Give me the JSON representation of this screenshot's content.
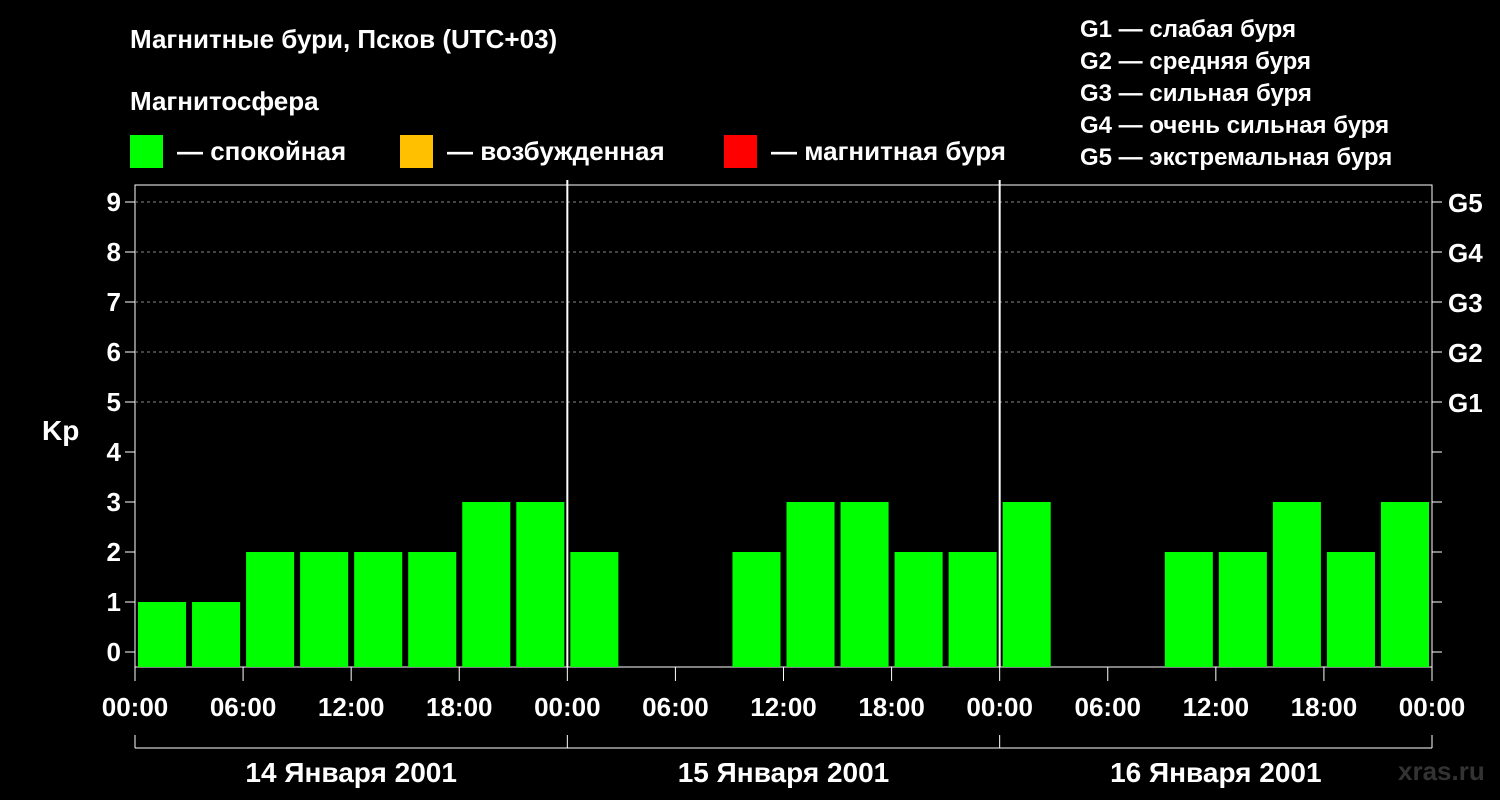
{
  "title": "Магнитные бури, Псков (UTC+03)",
  "subtitle": "Магнитосфера",
  "legend": [
    {
      "label": "— спокойная",
      "color": "#00ff00"
    },
    {
      "label": "— возбужденная",
      "color": "#ffc000"
    },
    {
      "label": "— магнитная буря",
      "color": "#ff0000"
    }
  ],
  "g_scale": [
    "G1 — слабая буря",
    "G2 — средняя буря",
    "G3 — сильная буря",
    "G4 — очень сильная буря",
    "G5 — экстремальная буря"
  ],
  "watermark": "xras.ru",
  "chart_data": {
    "type": "bar",
    "ylabel": "Kp",
    "ylim": [
      0,
      9
    ],
    "yticks": [
      "0",
      "1",
      "2",
      "3",
      "4",
      "5",
      "6",
      "7",
      "8",
      "9"
    ],
    "right_ticks": [
      {
        "value": 5,
        "label": "G1"
      },
      {
        "value": 6,
        "label": "G2"
      },
      {
        "value": 7,
        "label": "G3"
      },
      {
        "value": 8,
        "label": "G4"
      },
      {
        "value": 9,
        "label": "G5"
      }
    ],
    "grid": "dashed, Kp 5–9",
    "xticks": [
      "00:00",
      "06:00",
      "12:00",
      "18:00",
      "00:00",
      "06:00",
      "12:00",
      "18:00",
      "00:00",
      "06:00",
      "12:00",
      "18:00",
      "00:00"
    ],
    "days": [
      "14 Января 2001",
      "15 Января 2001",
      "16 Января 2001"
    ],
    "bar_color": "#00ff00",
    "values": [
      1,
      1,
      2,
      2,
      2,
      2,
      3,
      3,
      2,
      0,
      0,
      2,
      3,
      3,
      2,
      2,
      3,
      0,
      0,
      2,
      2,
      3,
      2,
      3
    ]
  }
}
